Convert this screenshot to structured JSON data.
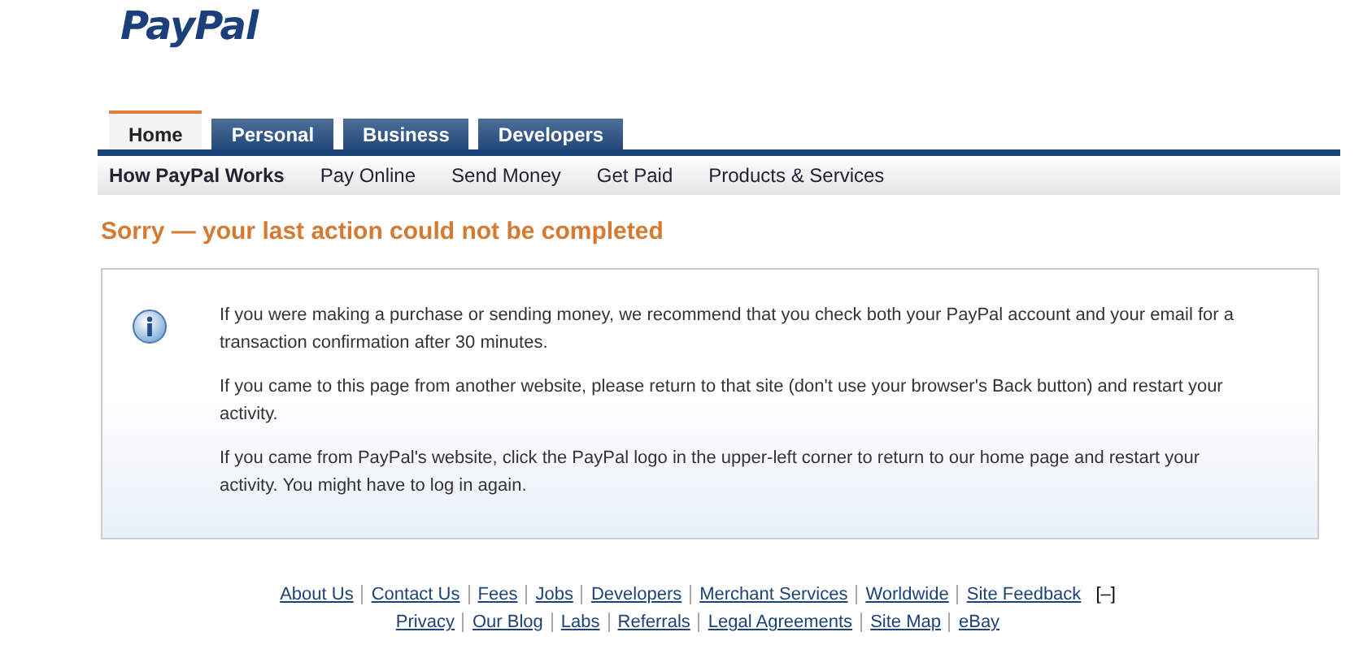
{
  "logo": "PayPal",
  "tabs": [
    {
      "label": "Home",
      "selected": true
    },
    {
      "label": "Personal",
      "selected": false
    },
    {
      "label": "Business",
      "selected": false
    },
    {
      "label": "Developers",
      "selected": false
    }
  ],
  "subnav": [
    {
      "label": "How PayPal Works",
      "selected": true
    },
    {
      "label": "Pay Online",
      "selected": false
    },
    {
      "label": "Send Money",
      "selected": false
    },
    {
      "label": "Get Paid",
      "selected": false
    },
    {
      "label": "Products & Services",
      "selected": false
    }
  ],
  "heading": "Sorry — your last action could not be completed",
  "message": {
    "paragraphs": [
      "If you were making a purchase or sending money, we recommend that you check both your PayPal account and your email for a transaction confirmation after 30 minutes.",
      "If you came to this page from another website, please return to that site (don't use your browser's Back button) and restart your activity.",
      "If you came from PayPal's website, click the PayPal logo in the upper-left corner to return to our home page and restart your activity. You might have to log in again."
    ]
  },
  "footer": {
    "primary_links": [
      "About Us",
      "Contact Us",
      "Fees",
      "Jobs",
      "Developers",
      "Merchant Services",
      "Worldwide",
      "Site Feedback"
    ],
    "secondary_links": [
      "Privacy",
      "Our Blog",
      "Labs",
      "Referrals",
      "Legal Agreements",
      "Site Map",
      "eBay"
    ],
    "feedback_mark": "[–]"
  }
}
